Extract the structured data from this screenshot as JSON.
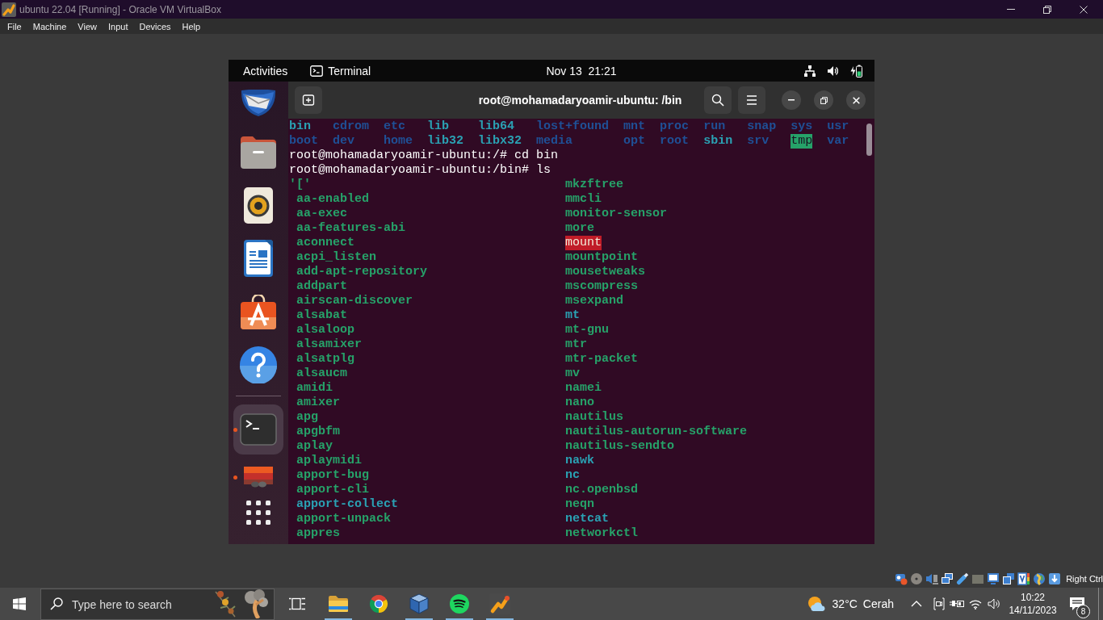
{
  "host_window": {
    "title": "ubuntu 22.04 [Running] - Oracle VM VirtualBox",
    "menu": [
      "File",
      "Machine",
      "View",
      "Input",
      "Devices",
      "Help"
    ]
  },
  "guest": {
    "top_bar": {
      "activities": "Activities",
      "app_menu": "Terminal",
      "clock": "Nov 13  21:21"
    },
    "dock": {
      "favorites": [
        {
          "kind": "mail",
          "running": false,
          "selected": false
        },
        {
          "kind": "files",
          "running": false,
          "selected": false
        },
        {
          "kind": "music",
          "running": false,
          "selected": false
        },
        {
          "kind": "writer",
          "running": false,
          "selected": false
        },
        {
          "kind": "software",
          "running": false,
          "selected": false
        },
        {
          "kind": "help",
          "running": false,
          "selected": false
        }
      ],
      "others": [
        {
          "kind": "terminal",
          "running": true,
          "selected": true
        },
        {
          "kind": "drive",
          "running": true,
          "selected": false
        }
      ]
    },
    "terminal": {
      "title": "root@mohamadaryoamir-ubuntu: /bin",
      "output": [
        {
          "kind": "listing",
          "rows": [
            [
              {
                "name": "bin",
                "kind": "link"
              },
              {
                "name": "cdrom",
                "kind": "dir"
              },
              {
                "name": "etc",
                "kind": "dir"
              },
              {
                "name": "lib",
                "kind": "link"
              },
              {
                "name": "lib64",
                "kind": "link"
              },
              {
                "name": "lost+found",
                "kind": "dir"
              },
              {
                "name": "mnt",
                "kind": "dir"
              },
              {
                "name": "proc",
                "kind": "dir"
              },
              {
                "name": "run",
                "kind": "dir"
              },
              {
                "name": "snap",
                "kind": "dir"
              },
              {
                "name": "sys",
                "kind": "dir"
              },
              {
                "name": "usr",
                "kind": "dir"
              }
            ],
            [
              {
                "name": "boot",
                "kind": "dir"
              },
              {
                "name": "dev",
                "kind": "dir"
              },
              {
                "name": "home",
                "kind": "dir"
              },
              {
                "name": "lib32",
                "kind": "link"
              },
              {
                "name": "libx32",
                "kind": "link"
              },
              {
                "name": "media",
                "kind": "dir"
              },
              {
                "name": "opt",
                "kind": "dir"
              },
              {
                "name": "root",
                "kind": "dir"
              },
              {
                "name": "sbin",
                "kind": "link"
              },
              {
                "name": "srv",
                "kind": "dir"
              },
              {
                "name": "tmp",
                "kind": "sticky-dir"
              },
              {
                "name": "var",
                "kind": "dir"
              }
            ]
          ]
        },
        {
          "kind": "command",
          "text": "root@mohamadaryoamir-ubuntu:/# cd bin"
        },
        {
          "kind": "command",
          "text": "root@mohamadaryoamir-ubuntu:/bin# ls"
        },
        {
          "kind": "listing",
          "rows": [
            [
              {
                "name": "'['",
                "kind": "exec"
              },
              {
                "name": "mkzftree",
                "kind": "exec"
              }
            ],
            [
              {
                "name": "aa-enabled",
                "kind": "exec"
              },
              {
                "name": "mmcli",
                "kind": "exec"
              }
            ],
            [
              {
                "name": "aa-exec",
                "kind": "exec"
              },
              {
                "name": "monitor-sensor",
                "kind": "exec"
              }
            ],
            [
              {
                "name": "aa-features-abi",
                "kind": "exec"
              },
              {
                "name": "more",
                "kind": "exec"
              }
            ],
            [
              {
                "name": "aconnect",
                "kind": "exec"
              },
              {
                "name": "mount",
                "kind": "setuid"
              }
            ],
            [
              {
                "name": "acpi_listen",
                "kind": "exec"
              },
              {
                "name": "mountpoint",
                "kind": "exec"
              }
            ],
            [
              {
                "name": "add-apt-repository",
                "kind": "exec"
              },
              {
                "name": "mousetweaks",
                "kind": "exec"
              }
            ],
            [
              {
                "name": "addpart",
                "kind": "exec"
              },
              {
                "name": "mscompress",
                "kind": "exec"
              }
            ],
            [
              {
                "name": "airscan-discover",
                "kind": "exec"
              },
              {
                "name": "msexpand",
                "kind": "exec"
              }
            ],
            [
              {
                "name": "alsabat",
                "kind": "exec"
              },
              {
                "name": "mt",
                "kind": "link"
              }
            ],
            [
              {
                "name": "alsaloop",
                "kind": "exec"
              },
              {
                "name": "mt-gnu",
                "kind": "exec"
              }
            ],
            [
              {
                "name": "alsamixer",
                "kind": "exec"
              },
              {
                "name": "mtr",
                "kind": "exec"
              }
            ],
            [
              {
                "name": "alsatplg",
                "kind": "exec"
              },
              {
                "name": "mtr-packet",
                "kind": "exec"
              }
            ],
            [
              {
                "name": "alsaucm",
                "kind": "exec"
              },
              {
                "name": "mv",
                "kind": "exec"
              }
            ],
            [
              {
                "name": "amidi",
                "kind": "exec"
              },
              {
                "name": "namei",
                "kind": "exec"
              }
            ],
            [
              {
                "name": "amixer",
                "kind": "exec"
              },
              {
                "name": "nano",
                "kind": "exec"
              }
            ],
            [
              {
                "name": "apg",
                "kind": "exec"
              },
              {
                "name": "nautilus",
                "kind": "exec"
              }
            ],
            [
              {
                "name": "apgbfm",
                "kind": "exec"
              },
              {
                "name": "nautilus-autorun-software",
                "kind": "exec"
              }
            ],
            [
              {
                "name": "aplay",
                "kind": "exec"
              },
              {
                "name": "nautilus-sendto",
                "kind": "exec"
              }
            ],
            [
              {
                "name": "aplaymidi",
                "kind": "exec"
              },
              {
                "name": "nawk",
                "kind": "link"
              }
            ],
            [
              {
                "name": "apport-bug",
                "kind": "exec"
              },
              {
                "name": "nc",
                "kind": "link"
              }
            ],
            [
              {
                "name": "apport-cli",
                "kind": "exec"
              },
              {
                "name": "nc.openbsd",
                "kind": "exec"
              }
            ],
            [
              {
                "name": "apport-collect",
                "kind": "link"
              },
              {
                "name": "neqn",
                "kind": "exec"
              }
            ],
            [
              {
                "name": "apport-unpack",
                "kind": "exec"
              },
              {
                "name": "netcat",
                "kind": "link"
              }
            ],
            [
              {
                "name": "appres",
                "kind": "exec"
              },
              {
                "name": "networkctl",
                "kind": "exec"
              }
            ]
          ]
        }
      ]
    }
  },
  "vm_status_bar": {
    "host_key": "Right Ctrl"
  },
  "taskbar": {
    "search": {
      "placeholder": "Type here to search"
    },
    "apps": [
      {
        "kind": "file-explorer",
        "running": true
      },
      {
        "kind": "chrome",
        "running": false
      },
      {
        "kind": "virtualbox",
        "running": true
      },
      {
        "kind": "spotify",
        "running": true
      },
      {
        "kind": "vm",
        "running": true
      }
    ],
    "weather": {
      "temperature": "32°C",
      "condition": "Cerah"
    },
    "clock": {
      "time": "10:22",
      "date": "14/11/2023"
    },
    "notifications": {
      "count": "8"
    }
  }
}
